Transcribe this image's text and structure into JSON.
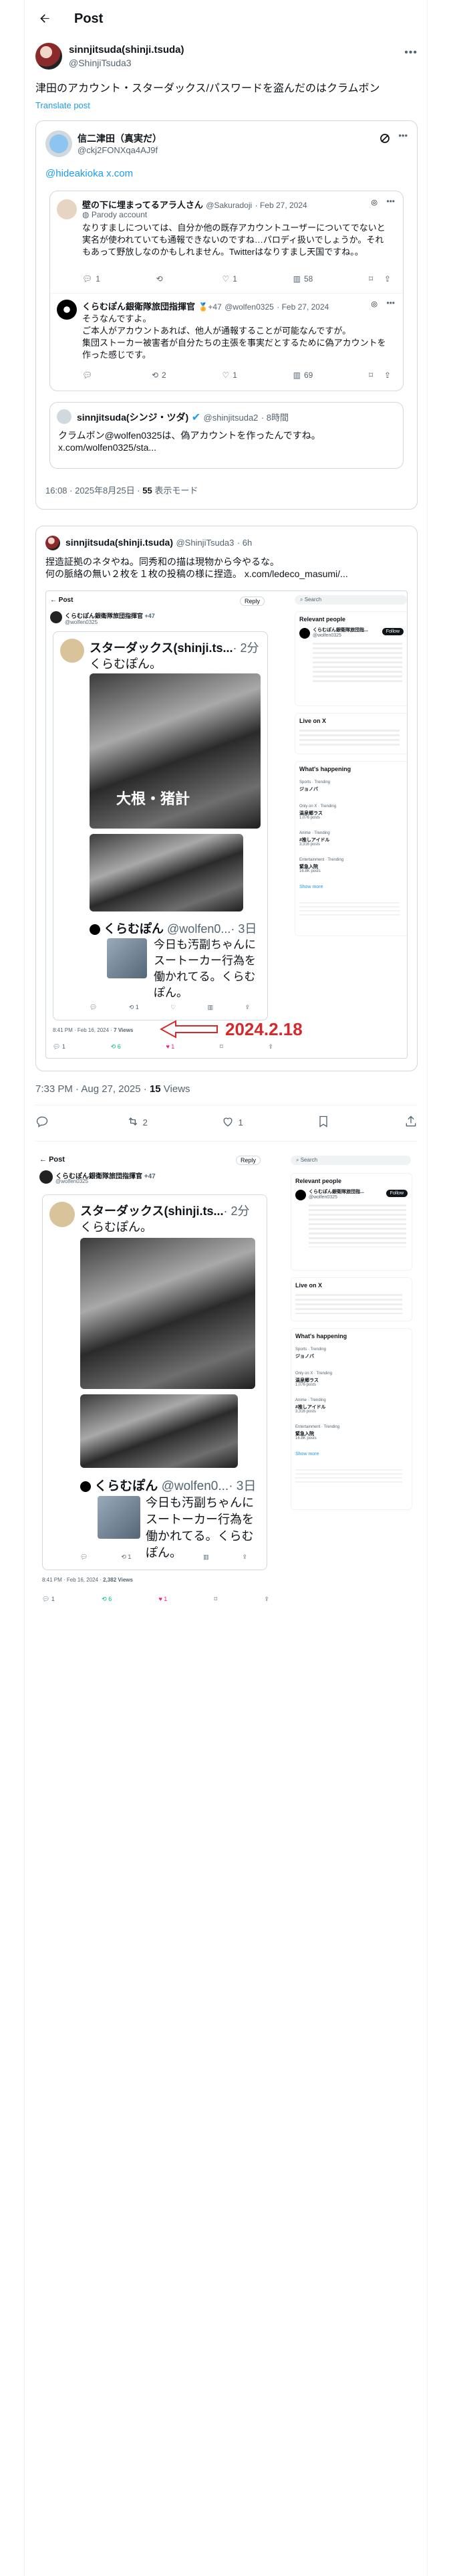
{
  "header": {
    "title": "Post"
  },
  "main": {
    "author": {
      "name": "sinnjitsuda(shinji.tsuda)",
      "handle": "@ShinjiTsuda3"
    },
    "text": "津田のアカウント・スターダックス/パスワードを盗んだのはクラムボン",
    "translate": "Translate post",
    "timestamp": "7:33 PM · Aug 27, 2025 · ",
    "views_count": "15",
    "views_label": " Views",
    "actions": {
      "reply": "",
      "repost": "2",
      "like": "1"
    }
  },
  "quote1": {
    "author": {
      "name": "信二津田（真実だ）",
      "handle": "@ckj2FONXqa4AJ9f"
    },
    "link": "@hideakioka x.com",
    "reply1": {
      "name": "壁の下に埋まってるアラ人さん",
      "handle": "@Sakuradoji",
      "date": "· Feb 27, 2024",
      "label": "Parody account",
      "text": "なりすましについては、自分か他の既存アカウントユーザーについてでないと実名が使われていても通報できないのですね…パロディ扱いでしょうか。それもあって野放しなのかもしれません。Twitterはなりすまし天国ですね。。",
      "stats": [
        "1",
        "",
        "1",
        "58"
      ]
    },
    "reply2": {
      "name": "くらむぽん銀衛隊旅団指揮官",
      "badge": "+47",
      "handle": "@wolfen0325",
      "date": "· Feb 27, 2024",
      "text": "そうなんですよ。\nご本人がアカウントあれば、他人が通報することが可能なんですが。\n集団ストーカー被害者が自分たちの主張を事実だとするために偽アカウントを作った感じです。",
      "stats": [
        "",
        "2",
        "1",
        "69"
      ]
    },
    "inner": {
      "name": "sinnjitsuda(シンジ・ツダ)",
      "handle": "@shinjitsuda2",
      "time": "· 8時間",
      "text": "クラムボン@wolfen0325は、偽アカウントを作ったんですね。\nx.com/wolfen0325/sta..."
    },
    "footer_time": "16:08 · 2025年8月25日 · ",
    "footer_views": "55",
    "footer_views_label": " 表示モード"
  },
  "quote2": {
    "author": {
      "name": "sinnjitsuda(shinji.tsuda)",
      "handle": "@ShinjiTsuda3",
      "time": "· 6h"
    },
    "text": "捏造証拠のネタやね。同秀和の描は現物から今やるな。\n何の脈絡の無い２枚を１枚の投稿の様に捏造。 x.com/ledeco_masumi/...",
    "shot": {
      "post_title": "Post",
      "reply_btn": "Reply",
      "name": "くらむぽん銀衛隊旅団指揮官",
      "badge": "+47",
      "handle": "@wolfen0325",
      "date_line": "8:41 PM · Feb 16, 2024 · ",
      "views": "7 Views",
      "big_card_name": "スターダックス(shinji.ts...",
      "big_card_time": "· 2分",
      "big_card_text": "くらむぽん。",
      "photo_caption1": "大根・猪計",
      "sub_name": "くらむぽん",
      "sub_handle": "@wolfen0...",
      "sub_time": "· 3日",
      "sub_text": "今日も汚副ちゃんにスートーカー行為を働かれてる。くらむぽん。",
      "annotation": "2024.2.18",
      "right": {
        "search": "Search",
        "relevant": "Relevant people",
        "follow": "Follow",
        "person_name": "くらむぽん銀衛隊旅団指...",
        "person_handle": "@wolfen0325",
        "live": "Live on X",
        "happening": "What's happening",
        "trends": [
          {
            "cat": "Sports · Trending",
            "title": "ジョノバ",
            "count": "—"
          },
          {
            "cat": "Only on X · Trending",
            "title": "温泉郷ラス",
            "count": "1,076 posts"
          },
          {
            "cat": "Anime · Trending",
            "title": "#推しアイドル",
            "count": "3,316 posts"
          },
          {
            "cat": "Entertainment · Trending",
            "title": "緊急入院",
            "count": "16.8K posts"
          }
        ],
        "show_more": "Show more"
      }
    }
  },
  "screenshot2": {
    "post_title": "Post",
    "reply_btn": "Reply",
    "name": "くらむぽん銀衛隊旅団指揮官",
    "badge": "+47",
    "handle": "@wolfen0325",
    "card_name": "スターダックス(shinji.ts...",
    "card_time": "· 2分",
    "card_text": "くらむぽん。",
    "sub_name": "くらむぽん",
    "sub_handle": "@wolfen0...",
    "sub_time": "· 3日",
    "sub_text": "今日も汚副ちゃんにスートーカー行為を働かれてる。くらむぽん。",
    "date_line": "8:41 PM · Feb 16, 2024 · ",
    "views": "2,382 Views",
    "right": {
      "search": "Search",
      "relevant": "Relevant people",
      "follow": "Follow",
      "person_name": "くらむぽん銀衛隊旅団指...",
      "person_handle": "@wolfen0325",
      "live": "Live on X",
      "happening": "What's happening",
      "trends": [
        {
          "cat": "Sports · Trending",
          "title": "ジョノバ",
          "count": "—"
        },
        {
          "cat": "Only on X · Trending",
          "title": "温泉郷ラス",
          "count": "1,076 posts"
        },
        {
          "cat": "Anime · Trending",
          "title": "#推しアイドル",
          "count": "3,316 posts"
        },
        {
          "cat": "Entertainment · Trending",
          "title": "緊急入院",
          "count": "16.8K posts"
        }
      ],
      "show_more": "Show more"
    }
  },
  "colors": {
    "accent": "#1d9bf0",
    "border": "#cfd9de",
    "annotation": "#d62a2a"
  }
}
